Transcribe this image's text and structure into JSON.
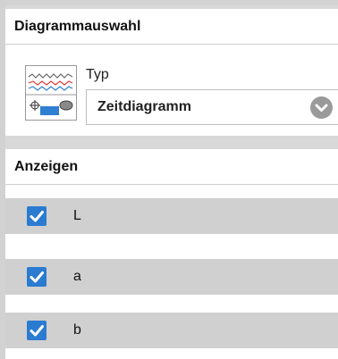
{
  "panel": {
    "section1_title": "Diagrammauswahl",
    "type_label": "Typ",
    "selected_type": "Zeitdiagramm",
    "section2_title": "Anzeigen"
  },
  "display_options": [
    {
      "label": "L",
      "checked": true
    },
    {
      "label": "a",
      "checked": true
    },
    {
      "label": "b",
      "checked": true
    }
  ],
  "icons": {
    "thumbnail": "time-diagram-thumbnail-icon",
    "dropdown": "chevron-down-icon",
    "checkmark": "checkmark-icon"
  },
  "colors": {
    "checkbox": "#2b7bd1",
    "row_background": "#d0d0d0",
    "section_divider": "#d9d9d9",
    "thumb_red": "#e23b3b",
    "thumb_blue": "#2f7fd3"
  }
}
